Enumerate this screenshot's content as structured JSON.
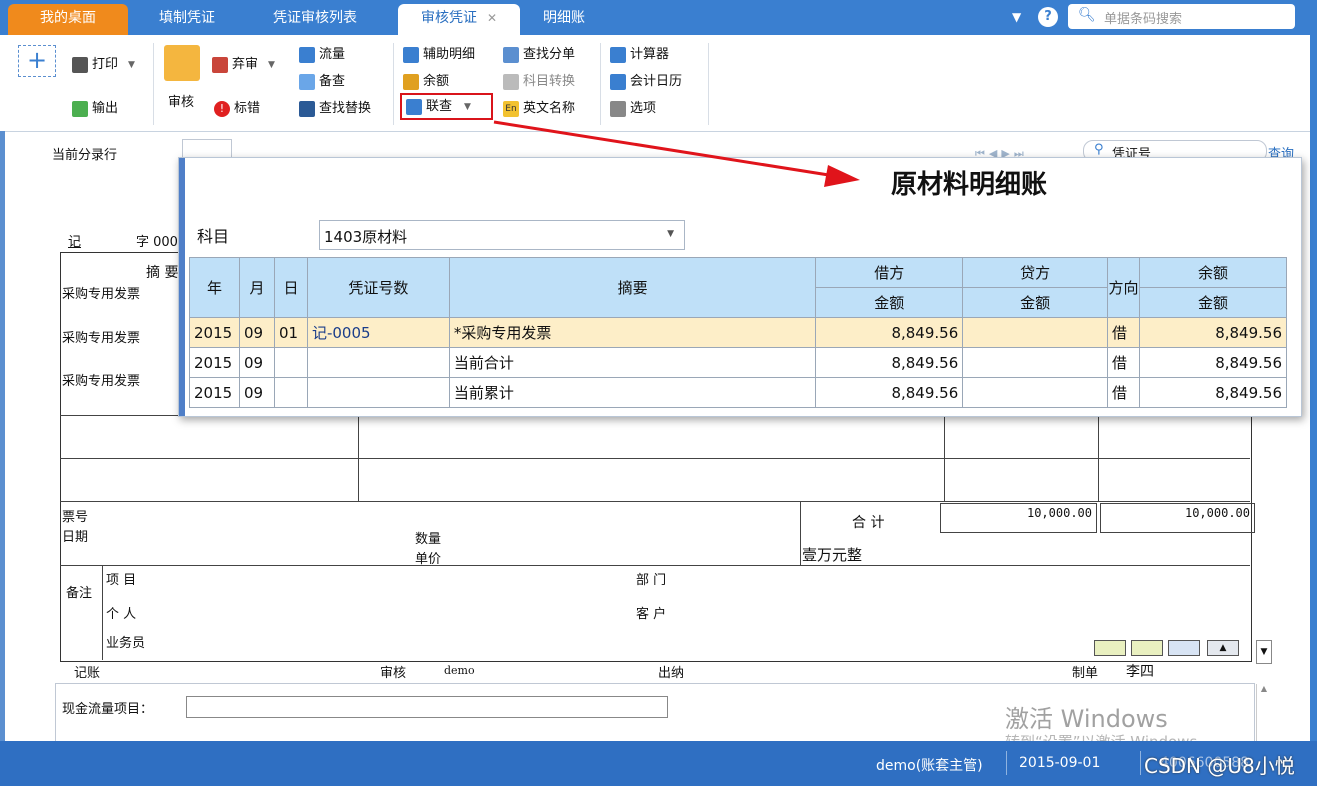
{
  "tabs": [
    {
      "label": "我的桌面"
    },
    {
      "label": "填制凭证"
    },
    {
      "label": "凭证审核列表"
    },
    {
      "label": "审核凭证"
    },
    {
      "label": "明细账"
    }
  ],
  "topbar": {
    "search_placeholder": "单据条码搜索",
    "help": "?"
  },
  "toolbar": {
    "add": "+",
    "print": "打印",
    "export": "输出",
    "audit": "审核",
    "abandon": "弃审",
    "mark_error": "标错",
    "cashflow": "流量",
    "backup_check": "备查",
    "find_replace": "查找替换",
    "aux_detail": "辅助明细",
    "balance": "余额",
    "link_query": "联查",
    "find_split": "查找分单",
    "subject_convert": "科目转换",
    "english_name": "英文名称",
    "calculator": "计算器",
    "accounting_calendar": "会计日历",
    "options": "选项"
  },
  "voucher": {
    "current_row_label": "当前分录行",
    "voucher_type": "记",
    "zi": "字 000",
    "summary_header": "摘  要",
    "rows": [
      "采购专用发票",
      "采购专用发票",
      "采购专用发票"
    ],
    "ticket_no": "票号",
    "date": "日期",
    "quantity": "数量",
    "unit_price": "单价",
    "total_label": "合 计",
    "total_debit": "10,000.00",
    "total_credit": "10,000.00",
    "amount_words": "壹万元整",
    "remark": "备注",
    "project": "项  目",
    "department": "部  门",
    "person": "个  人",
    "customer": "客  户",
    "salesman": "业务员",
    "bookkeeper": "记账",
    "auditor": "审核",
    "auditor_value": "demo",
    "cashier": "出纳",
    "maker": "制单",
    "maker_value": "李四",
    "cashflow_item": "现金流量项目：",
    "query_link": "查询",
    "voucher_no_search": "凭证号"
  },
  "popup": {
    "title": "原材料明细账",
    "subject_label": "科目",
    "subject_value": "1403原材料",
    "headers": {
      "year": "年",
      "month": "月",
      "day": "日",
      "voucher_no": "凭证号数",
      "summary": "摘要",
      "debit": "借方",
      "credit": "贷方",
      "direction": "方向",
      "balance": "余额",
      "amount": "金额"
    },
    "rows": [
      {
        "year": "2015",
        "month": "09",
        "day": "01",
        "voucher": "记-0005",
        "summary": "*采购专用发票",
        "debit": "8,849.56",
        "credit": "",
        "dir": "借",
        "balance": "8,849.56"
      },
      {
        "year": "2015",
        "month": "09",
        "day": "",
        "voucher": "",
        "summary": "当前合计",
        "debit": "8,849.56",
        "credit": "",
        "dir": "借",
        "balance": "8,849.56"
      },
      {
        "year": "2015",
        "month": "09",
        "day": "",
        "voucher": "",
        "summary": "当前累计",
        "debit": "8,849.56",
        "credit": "",
        "dir": "借",
        "balance": "8,849.56"
      }
    ]
  },
  "watermark": {
    "line1": "激活 Windows",
    "line2": "转到“设置”以激活 Windows。",
    "csdn": "CSDN @U8小悦"
  },
  "status": {
    "user": "demo(账套主管)",
    "date": "2015-09-01",
    "extra": "4006600588"
  },
  "colors": {
    "brand": "#3a7fd0",
    "home_tab": "#f08a1c",
    "highlight": "#ffe9c2",
    "red_box": "#d9141b"
  }
}
